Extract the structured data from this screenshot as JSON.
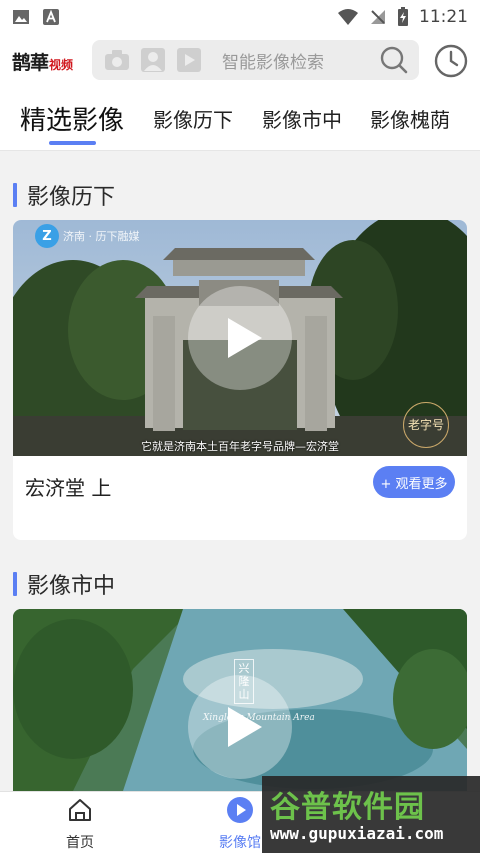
{
  "status_bar": {
    "time": "11:21"
  },
  "header": {
    "logo_main": "鹊華",
    "logo_sub": "视频",
    "search_placeholder": "智能影像检索"
  },
  "tabs": [
    {
      "label": "精选影像",
      "active": true
    },
    {
      "label": "影像历下"
    },
    {
      "label": "影像市中"
    },
    {
      "label": "影像槐荫"
    }
  ],
  "sections": [
    {
      "title": "影像历下",
      "card_title": "宏济堂 上",
      "more_label": "+ 观看更多",
      "video": {
        "watermark": "济南 · 历下融媒",
        "subtitle": "它就是济南本土百年老字号品牌—宏济堂",
        "corner_badge": "老字号"
      }
    },
    {
      "title": "影像市中",
      "video": {
        "overlay_text": "兴隆山",
        "overlay_sub": "Xinglong Mountain Area"
      }
    }
  ],
  "bottom_nav": [
    {
      "label": "首页",
      "icon": "home-icon"
    },
    {
      "label": "影像馆",
      "icon": "play-circle-icon",
      "active": true
    }
  ],
  "site_watermark": {
    "brand": "谷普软件园",
    "url": "www.gupuxiazai.com"
  },
  "colors": {
    "accent": "#5b7ff3",
    "logo_red": "#d0181e"
  }
}
